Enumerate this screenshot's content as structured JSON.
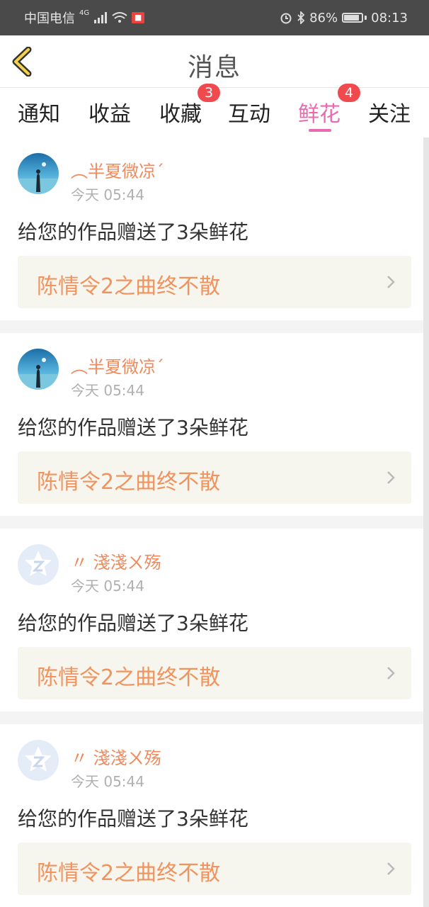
{
  "status_bar": {
    "carrier": "中国电信",
    "network": "4G",
    "battery": "86%",
    "time": "08:13",
    "battery_level": 0.86
  },
  "header": {
    "title": "消息",
    "back_icon": "chevron-left-icon"
  },
  "tabs": [
    {
      "label": "通知"
    },
    {
      "label": "收益"
    },
    {
      "label": "收藏",
      "badge": "3"
    },
    {
      "label": "互动"
    },
    {
      "label": "鲜花",
      "badge": "4",
      "active": true
    },
    {
      "label": "关注"
    }
  ],
  "messages": [
    {
      "user": "︵半夏微凉´",
      "time": "今天 05:44",
      "text": "给您的作品赠送了3朵鲜花",
      "work": "陈情令2之曲终不散",
      "avatar": "photo-avatar"
    },
    {
      "user": "︵半夏微凉´",
      "time": "今天 05:44",
      "text": "给您的作品赠送了3朵鲜花",
      "work": "陈情令2之曲终不散",
      "avatar": "photo-avatar"
    },
    {
      "user": "〃 淺淺ㄨ殇",
      "time": "今天 05:44",
      "text": "给您的作品赠送了3朵鲜花",
      "work": "陈情令2之曲终不散",
      "avatar": "default-avatar"
    },
    {
      "user": "〃 淺淺ㄨ殇",
      "time": "今天 05:44",
      "text": "给您的作品赠送了3朵鲜花",
      "work": "陈情令2之曲终不散",
      "avatar": "default-avatar"
    }
  ],
  "colors": {
    "accent": "#e86ab0",
    "badge": "#f04a4f",
    "username": "#f08a5d",
    "work_title": "#f0935e"
  }
}
